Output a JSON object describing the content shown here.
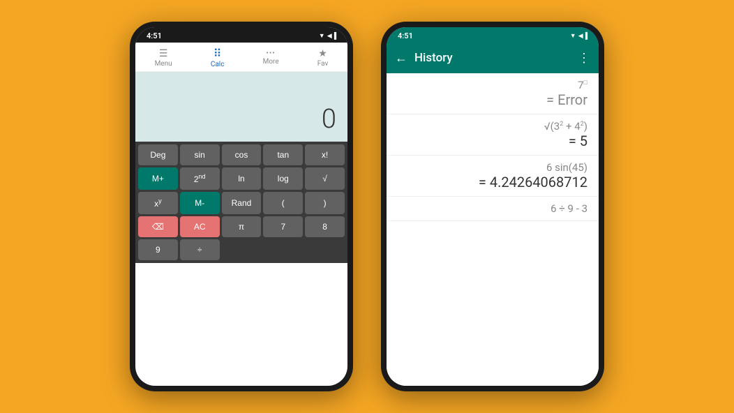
{
  "background": "#F5A623",
  "calculator_phone": {
    "status_bar": {
      "time": "4:51",
      "icons": "▼◀▐"
    },
    "nav": [
      {
        "label": "Menu",
        "icon": "☰",
        "active": false
      },
      {
        "label": "Calc",
        "icon": "⠿",
        "active": true
      },
      {
        "label": "More",
        "icon": "•••",
        "active": false
      },
      {
        "label": "Fav",
        "icon": "★",
        "active": false
      }
    ],
    "display": "0",
    "buttons": [
      {
        "label": "Deg",
        "type": "light"
      },
      {
        "label": "sin",
        "type": "light"
      },
      {
        "label": "cos",
        "type": "light"
      },
      {
        "label": "tan",
        "type": "light"
      },
      {
        "label": "x!",
        "type": "light"
      },
      {
        "label": "M+",
        "type": "teal"
      },
      {
        "label": "2ⁿᵈ",
        "type": "light"
      },
      {
        "label": "ln",
        "type": "light"
      },
      {
        "label": "log",
        "type": "light"
      },
      {
        "label": "√",
        "type": "light"
      },
      {
        "label": "xʸ",
        "type": "light"
      },
      {
        "label": "M-",
        "type": "teal"
      },
      {
        "label": "Rand",
        "type": "light"
      },
      {
        "label": "(",
        "type": "light"
      },
      {
        "label": ")",
        "type": "light"
      },
      {
        "label": "⌫",
        "type": "red"
      },
      {
        "label": "AC",
        "type": "red"
      },
      {
        "label": "π",
        "type": "light"
      },
      {
        "label": "7",
        "type": "light"
      },
      {
        "label": "8",
        "type": "light"
      },
      {
        "label": "9",
        "type": "light"
      },
      {
        "label": "÷",
        "type": "light"
      }
    ]
  },
  "history_phone": {
    "status_bar": {
      "time": "4:51",
      "icons": "▼◀▐"
    },
    "header": {
      "title": "History",
      "back": "←",
      "more": "⋮"
    },
    "items": [
      {
        "expression": "7□",
        "result": "= Error"
      },
      {
        "expression": "√(3² + 4²)",
        "result": "= 5"
      },
      {
        "expression": "6 sin(45)",
        "result": "= 4.24264068712"
      },
      {
        "expression": "6 ÷ 9 - 3",
        "result": ""
      }
    ]
  }
}
